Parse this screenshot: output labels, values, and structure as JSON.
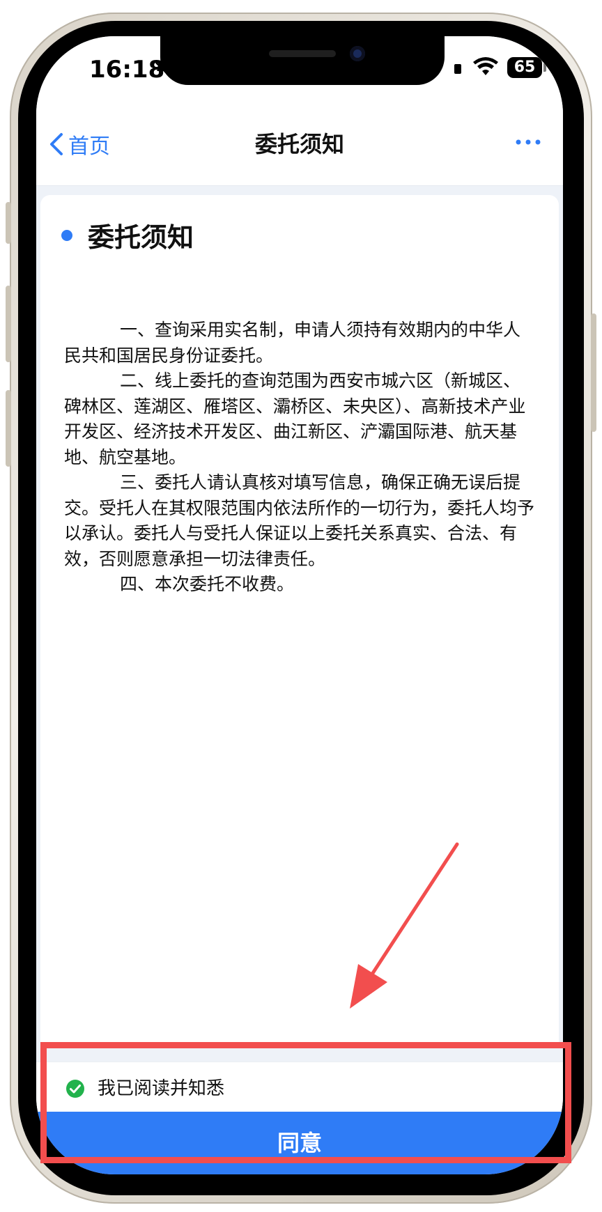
{
  "status_bar": {
    "time": "16:18",
    "battery": "65"
  },
  "nav": {
    "back_label": "首页",
    "title": "委托须知"
  },
  "card": {
    "heading": "委托须知",
    "paragraphs": [
      "一、查询采用实名制，申请人须持有效期内的中华人民共和国居民身份证委托。",
      "二、线上委托的查询范围为西安市城六区（新城区、碑林区、莲湖区、雁塔区、灞桥区、未央区）、高新技术产业开发区、经济技术开发区、曲江新区、浐灞国际港、航天基地、航空基地。",
      "三、委托人请认真核对填写信息，确保正确无误后提交。受托人在其权限范围内依法所作的一切行为，委托人均予以承认。委托人与受托人保证以上委托关系真实、合法、有效，否则愿意承担一切法律责任。",
      "四、本次委托不收费。"
    ]
  },
  "consent": {
    "label": "我已阅读并知悉",
    "checked": true,
    "check_color": "#22b24c"
  },
  "agree_button": {
    "label": "同意",
    "color": "#2f7cf6"
  },
  "annotation": {
    "color": "#f24e4e"
  },
  "icons": {
    "back": "chevron-left-icon",
    "more": "more-dots-icon",
    "bell": "bell-slash-icon",
    "wifi": "wifi-icon",
    "check": "check-circle-icon"
  }
}
